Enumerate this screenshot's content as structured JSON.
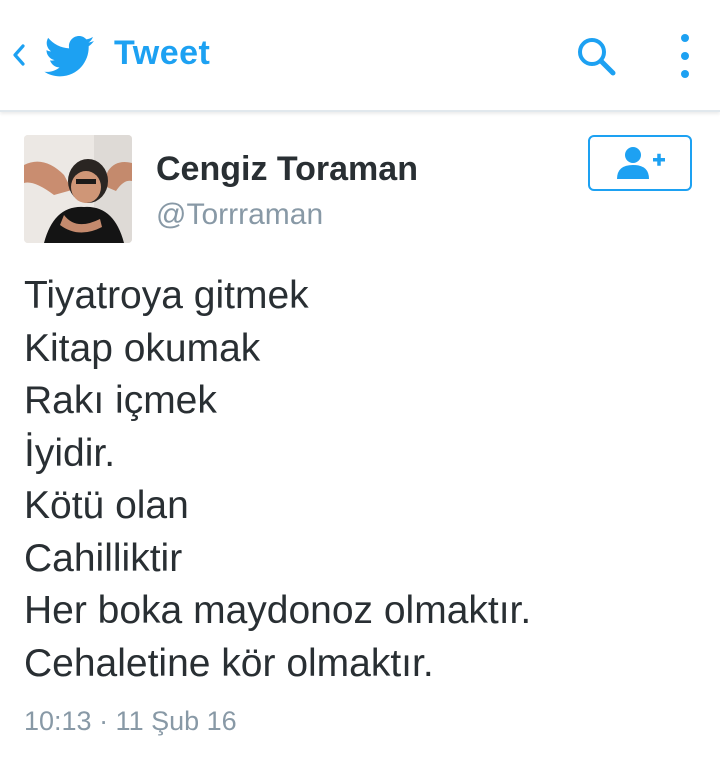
{
  "header": {
    "back_icon": "chevron-left-icon",
    "logo_icon": "twitter-bird-icon",
    "title": "Tweet",
    "search_icon": "search-icon",
    "more_icon": "more-vertical-icon",
    "accent_color": "#1da1f2"
  },
  "tweet": {
    "author_name": "Cengiz Toraman",
    "author_handle": "@Torrraman",
    "follow_icon": "add-user-icon",
    "lines": [
      "Tiyatroya gitmek",
      "Kitap okumak",
      "Rakı içmek",
      "İyidir.",
      "Kötü olan",
      "Cahilliktir",
      "Her boka maydonoz olmaktır.",
      "Cehaletine kör olmaktır."
    ],
    "timestamp": "10:13 · 11 Şub 16"
  },
  "colors": {
    "text": "#292f33",
    "muted": "#8899a6",
    "divider": "#e1e8ed"
  }
}
